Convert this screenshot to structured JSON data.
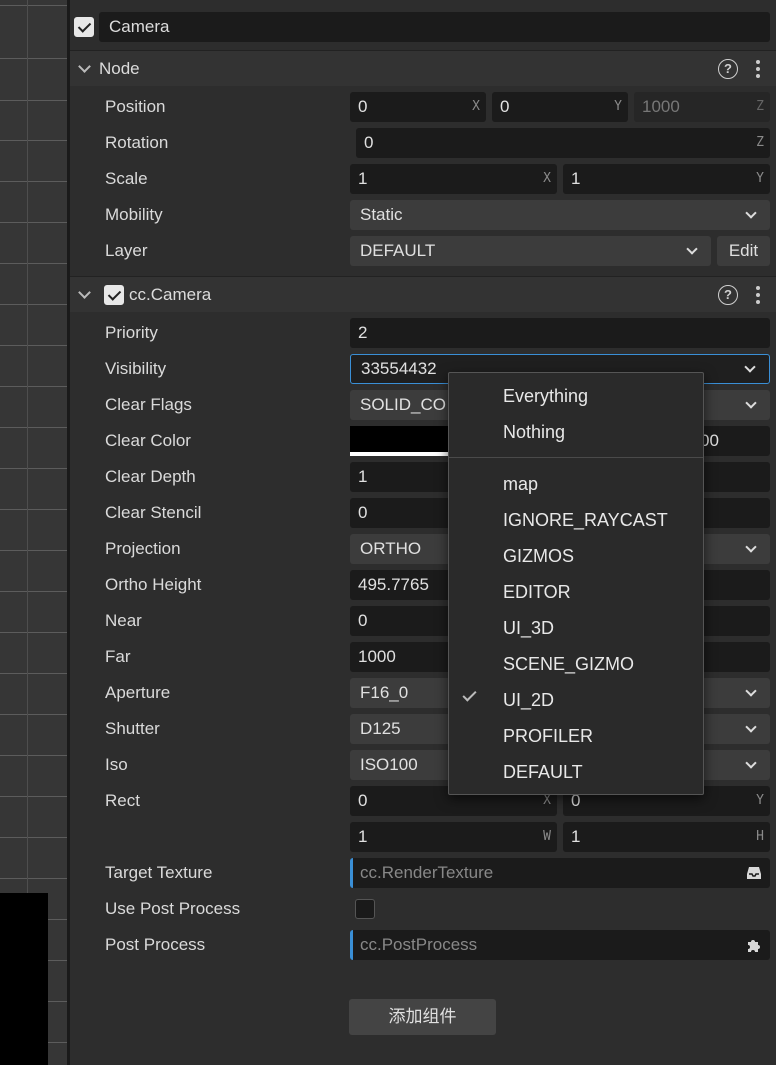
{
  "node": {
    "name": "Camera",
    "enabled": true,
    "section_title": "Node",
    "position": {
      "x": "0",
      "y": "0",
      "z": "1000"
    },
    "rotation": {
      "z": "0"
    },
    "scale": {
      "x": "1",
      "y": "1"
    },
    "mobility": "Static",
    "layer": "DEFAULT",
    "labels": {
      "position": "Position",
      "rotation": "Rotation",
      "scale": "Scale",
      "mobility": "Mobility",
      "layer": "Layer"
    },
    "edit_label": "Edit"
  },
  "axes": {
    "x": "X",
    "y": "Y",
    "z": "Z",
    "w": "W",
    "h": "H"
  },
  "camera": {
    "section_title": "cc.Camera",
    "enabled": true,
    "labels": {
      "priority": "Priority",
      "visibility": "Visibility",
      "clear_flags": "Clear Flags",
      "clear_color": "Clear Color",
      "clear_depth": "Clear Depth",
      "clear_stencil": "Clear Stencil",
      "projection": "Projection",
      "ortho_height": "Ortho Height",
      "near": "Near",
      "far": "Far",
      "aperture": "Aperture",
      "shutter": "Shutter",
      "iso": "Iso",
      "rect": "Rect",
      "target_texture": "Target Texture",
      "use_post_process": "Use Post Process",
      "post_process": "Post Process"
    },
    "priority": "2",
    "visibility": "33554432",
    "clear_flags": "SOLID_CO",
    "clear_color_alpha_partial": "00",
    "clear_depth": "1",
    "clear_stencil": "0",
    "projection": "ORTHO",
    "ortho_height": "495.7765",
    "near": "0",
    "far": "1000",
    "aperture": "F16_0",
    "shutter": "D125",
    "iso": "ISO100",
    "rect": {
      "x": "0",
      "y": "0",
      "w": "1",
      "h": "1"
    },
    "target_texture_placeholder": "cc.RenderTexture",
    "use_post_process": false,
    "post_process_placeholder": "cc.PostProcess"
  },
  "add_component_label": "添加组件",
  "visibility_dropdown": {
    "top_items": [
      "Everything",
      "Nothing"
    ],
    "layers": [
      {
        "label": "map",
        "checked": false
      },
      {
        "label": "IGNORE_RAYCAST",
        "checked": false
      },
      {
        "label": "GIZMOS",
        "checked": false
      },
      {
        "label": "EDITOR",
        "checked": false
      },
      {
        "label": "UI_3D",
        "checked": false
      },
      {
        "label": "SCENE_GIZMO",
        "checked": false
      },
      {
        "label": "UI_2D",
        "checked": true
      },
      {
        "label": "PROFILER",
        "checked": false
      },
      {
        "label": "DEFAULT",
        "checked": false
      }
    ]
  },
  "icons": {
    "help": "help-icon",
    "menu": "more-vertical-icon",
    "inbox": "inbox-icon",
    "puzzle": "puzzle-icon"
  },
  "colors": {
    "accent": "#3a8fd6",
    "clear_color": "#000000"
  }
}
